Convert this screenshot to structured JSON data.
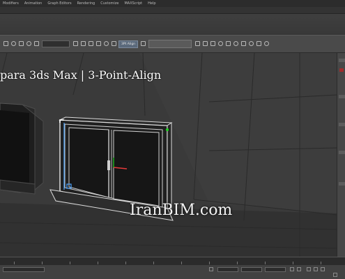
{
  "menubar": {
    "items": [
      "Modifiers",
      "Animation",
      "Graph Editors",
      "Rendering",
      "Customize",
      "MAXScript",
      "Help"
    ]
  },
  "toolbar": {
    "selection_label": "3Pt Align"
  },
  "overlay": {
    "title": "para 3ds Max | 3-Point-Align",
    "watermark": "IranBIM.com"
  },
  "colors": {
    "viewport_bg": "#3a3a3a",
    "wire": "#e8e8e8",
    "accent_green": "#20d420",
    "accent_red": "#e63a3a"
  }
}
